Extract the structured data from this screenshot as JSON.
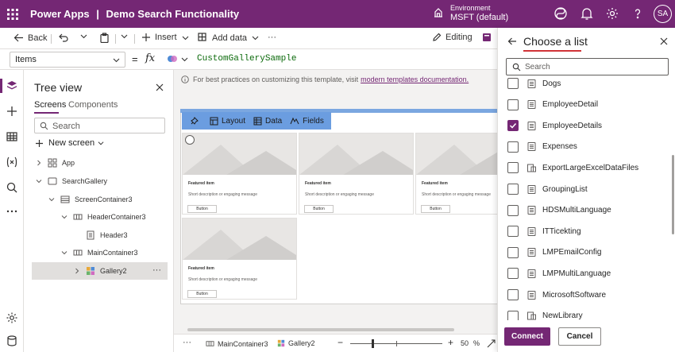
{
  "header": {
    "app_name": "Power Apps",
    "separator": "|",
    "app_title": "Demo Search Functionality",
    "environment_label": "Environment",
    "environment_value": "MSFT (default)",
    "avatar_initials": "SA"
  },
  "command_bar": {
    "back": "Back",
    "insert": "Insert",
    "add_data": "Add data",
    "more": "···",
    "editing": "Editing"
  },
  "formula_bar": {
    "property": "Items",
    "equals": "=",
    "fx": "fx",
    "formula": "CustomGallerySample"
  },
  "tree": {
    "title": "Tree view",
    "tabs": [
      "Screens",
      "Components"
    ],
    "search_placeholder": "Search",
    "new_screen": "New screen",
    "nodes": [
      "App",
      "SearchGallery",
      "ScreenContainer3",
      "HeaderContainer3",
      "Header3",
      "MainContainer3",
      "Gallery2"
    ],
    "more": "···"
  },
  "canvas": {
    "hint_text": "For best practices on customizing this template, visit",
    "hint_link": "modern templates documentation.",
    "toolbar": [
      "Layout",
      "Data",
      "Fields"
    ],
    "card_title": "Featured item",
    "card_desc": "Short description or engaging message",
    "card_button": "Button"
  },
  "status_bar": {
    "more": "···",
    "breadcrumb": [
      "MainContainer3",
      "Gallery2"
    ],
    "minus": "−",
    "plus": "+",
    "zoom": "50",
    "zoom_unit": "%"
  },
  "pane": {
    "title": "Choose a list",
    "search_placeholder": "Search",
    "items": [
      {
        "label": "Dogs",
        "checked": false,
        "icon": "list-icon"
      },
      {
        "label": "EmployeeDetail",
        "checked": false,
        "icon": "list-icon"
      },
      {
        "label": "EmployeeDetails",
        "checked": true,
        "icon": "list-icon"
      },
      {
        "label": "Expenses",
        "checked": false,
        "icon": "list-icon"
      },
      {
        "label": "ExportLargeExcelDataFiles",
        "checked": false,
        "icon": "library-icon"
      },
      {
        "label": "GroupingList",
        "checked": false,
        "icon": "list-icon"
      },
      {
        "label": "HDSMultiLanguage",
        "checked": false,
        "icon": "list-icon"
      },
      {
        "label": "ITTicekting",
        "checked": false,
        "icon": "list-icon"
      },
      {
        "label": "LMPEmailConfig",
        "checked": false,
        "icon": "list-icon"
      },
      {
        "label": "LMPMultiLanguage",
        "checked": false,
        "icon": "list-icon"
      },
      {
        "label": "MicrosoftSoftware",
        "checked": false,
        "icon": "list-icon"
      },
      {
        "label": "NewLibrary",
        "checked": false,
        "icon": "library-icon"
      }
    ],
    "connect": "Connect",
    "cancel": "Cancel"
  },
  "colors": {
    "brand": "#742774",
    "accent_underline": "#d13438",
    "canvas_toolbar": "#6b9de0"
  }
}
